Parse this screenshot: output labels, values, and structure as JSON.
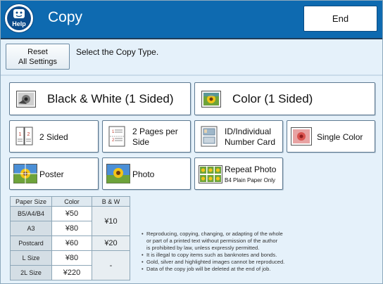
{
  "header": {
    "help_label": "Help",
    "title": "Copy",
    "end_label": "End"
  },
  "toolbar": {
    "reset_label_line1": "Reset",
    "reset_label_line2": "All Settings",
    "instruction": "Select the Copy Type."
  },
  "copy_types": {
    "bw_1sided": "Black & White (1 Sided)",
    "color_1sided": "Color (1 Sided)",
    "two_sided": "2 Sided",
    "two_pages_line1": "2 Pages per",
    "two_pages_line2": "Side",
    "id_line1": "ID/Individual",
    "id_line2": "Number Card",
    "single_color": "Single Color",
    "poster": "Poster",
    "photo": "Photo",
    "repeat_photo": "Repeat Photo",
    "repeat_photo_sub": "B4 Plain Paper Only"
  },
  "price_table": {
    "headers": [
      "Paper Size",
      "Color",
      "B & W"
    ],
    "rows": [
      {
        "size": "B5/A4/B4",
        "color": "¥50"
      },
      {
        "size": "A3",
        "color": "¥80"
      },
      {
        "size": "Postcard",
        "color": "¥60"
      },
      {
        "size": "L Size",
        "color": "¥80"
      },
      {
        "size": "2L Size",
        "color": "¥220"
      }
    ],
    "bw_values": [
      "¥10",
      "¥20",
      "-"
    ]
  },
  "notes": [
    "Reproducing, copying, changing, or adapting of the whole",
    "or part of a printed text without permission of the author",
    "is prohibited by law, unless expressly permitted.",
    "It is illegal to copy items such as banknotes and bonds.",
    "Gold, silver and highlighted images cannot be reproduced.",
    "Data of the copy job will be deleted at the end of job."
  ]
}
